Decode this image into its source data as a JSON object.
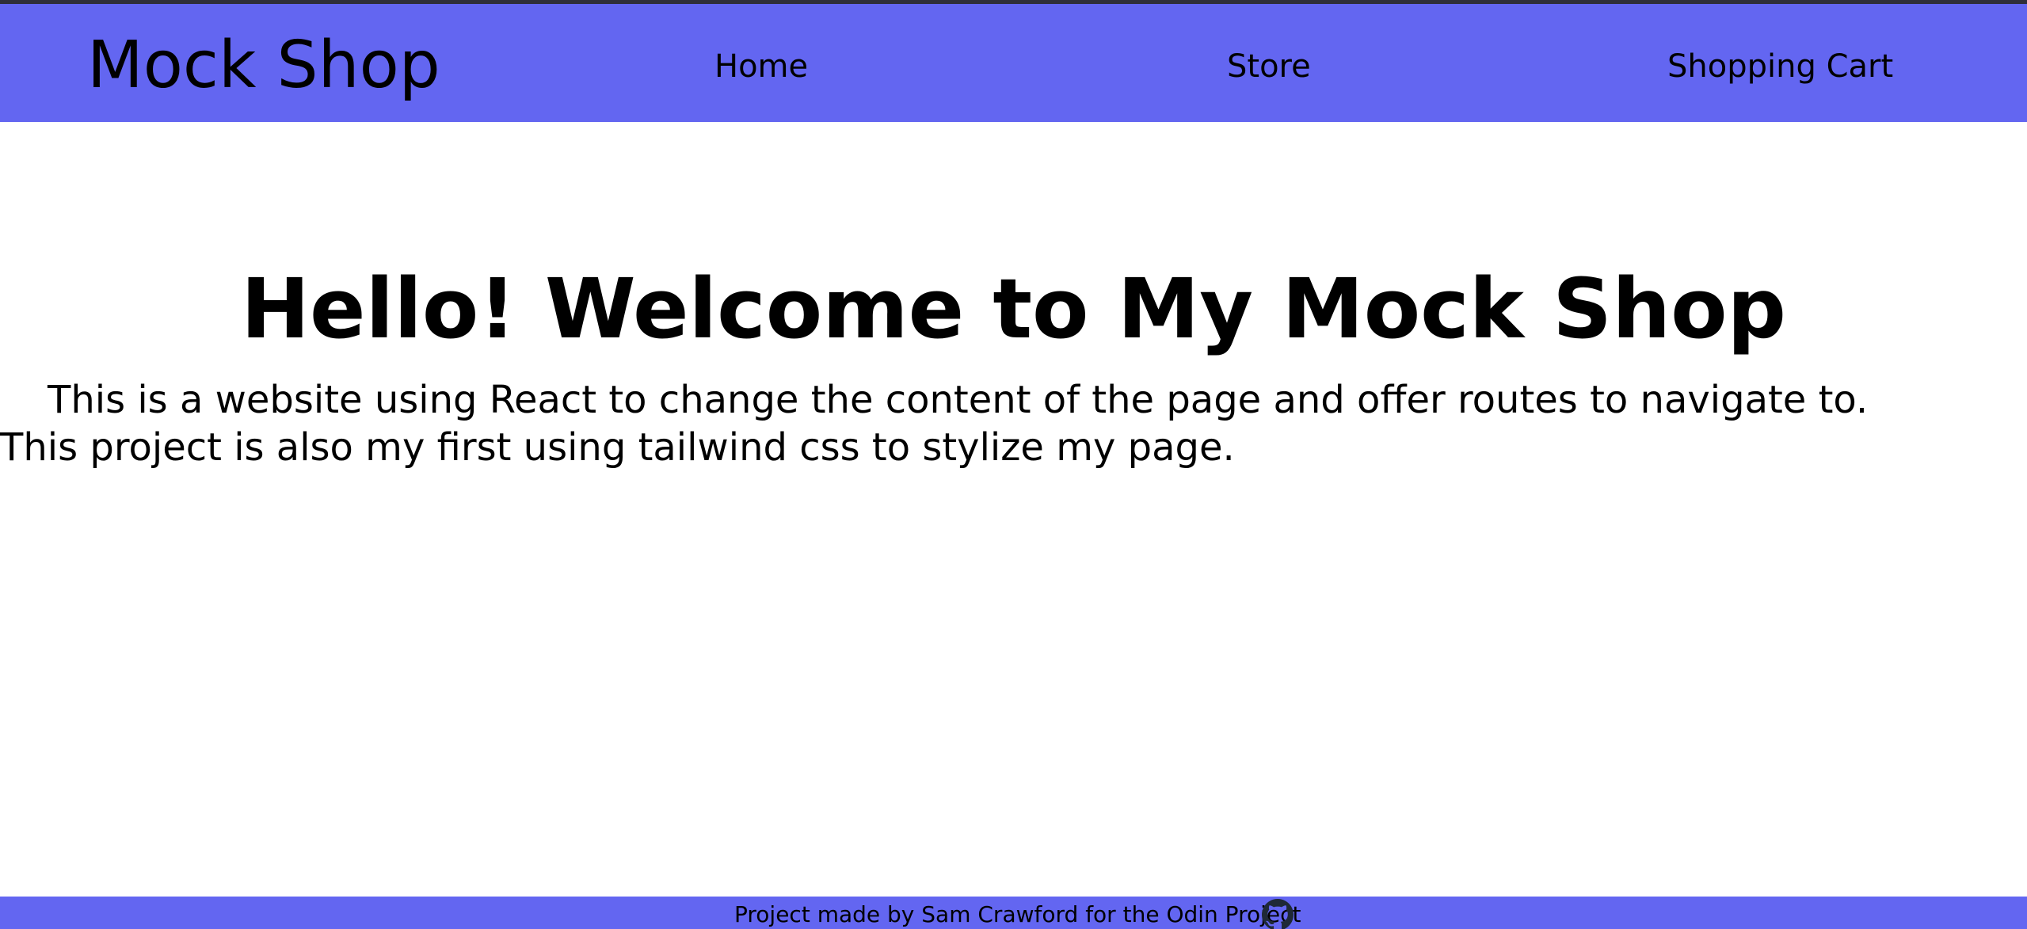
{
  "colors": {
    "brand": "#6366f1",
    "top_border": "#2f2f3a",
    "text": "#000000",
    "background": "#ffffff"
  },
  "header": {
    "title": "Mock Shop",
    "nav": {
      "home": "Home",
      "store": "Store",
      "cart": "Shopping Cart"
    }
  },
  "main": {
    "heading": "Hello! Welcome to My Mock Shop",
    "intro": "This is a website using React to change the content of the page and offer routes to navigate to. This project is also my first using tailwind css to stylize my page."
  },
  "footer": {
    "credit": "Project made by Sam Crawford for the Odin Project",
    "icon": "github-icon"
  }
}
